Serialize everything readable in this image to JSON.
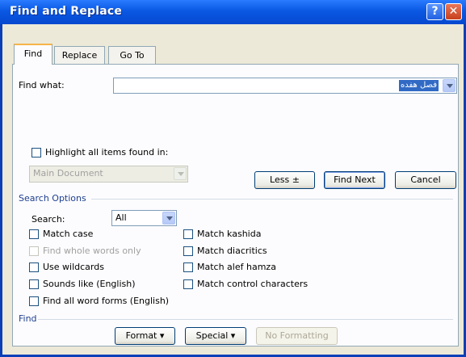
{
  "window": {
    "title": "Find and Replace"
  },
  "titlebar": {
    "help_glyph": "?",
    "close_glyph": "✕"
  },
  "tabs": [
    {
      "label": "Find",
      "active": true
    },
    {
      "label": "Replace",
      "active": false
    },
    {
      "label": "Go To",
      "active": false
    }
  ],
  "find_what": {
    "label": "Find what:",
    "value": "فصل هفده"
  },
  "highlight": {
    "label": "Highlight all items found in:",
    "checked": false,
    "scope_value": "Main Document"
  },
  "buttons": {
    "less": "Less ±",
    "find_next": "Find Next",
    "cancel": "Cancel"
  },
  "search_options": {
    "header": "Search Options",
    "search_label": "Search:",
    "search_value": "All",
    "left": [
      {
        "label": "Match case",
        "checked": false,
        "enabled": true
      },
      {
        "label": "Find whole words only",
        "checked": false,
        "enabled": false
      },
      {
        "label": "Use wildcards",
        "checked": false,
        "enabled": true
      },
      {
        "label": "Sounds like (English)",
        "checked": false,
        "enabled": true
      },
      {
        "label": "Find all word forms (English)",
        "checked": false,
        "enabled": true
      }
    ],
    "right": [
      {
        "label": "Match kashida",
        "checked": false,
        "enabled": true
      },
      {
        "label": "Match diacritics",
        "checked": false,
        "enabled": true
      },
      {
        "label": "Match alef hamza",
        "checked": false,
        "enabled": true
      },
      {
        "label": "Match control characters",
        "checked": false,
        "enabled": true
      }
    ]
  },
  "find_section": {
    "header": "Find",
    "format": "Format ▾",
    "special": "Special ▾",
    "no_formatting": "No Formatting"
  },
  "colors": {
    "title_bar": "#0a58e3",
    "dialog_face": "#ece9d8",
    "selection": "#316ac5",
    "section_header": "#1e3f8f"
  }
}
